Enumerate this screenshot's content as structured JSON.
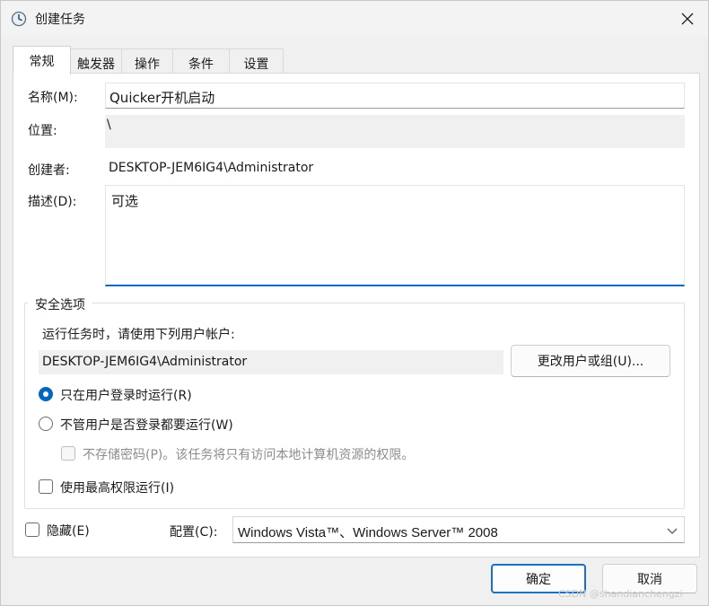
{
  "window": {
    "title": "创建任务"
  },
  "tabs": [
    {
      "label": "常规",
      "active": true
    },
    {
      "label": "触发器",
      "active": false
    },
    {
      "label": "操作",
      "active": false
    },
    {
      "label": "条件",
      "active": false
    },
    {
      "label": "设置",
      "active": false
    }
  ],
  "general": {
    "name_label": "名称(M):",
    "name_value": "Quicker开机启动",
    "location_label": "位置:",
    "location_value": "\\",
    "author_label": "创建者:",
    "author_value": "DESKTOP-JEM6IG4\\Administrator",
    "description_label": "描述(D):",
    "description_value": "可选"
  },
  "security": {
    "group_title": "安全选项",
    "run_as_label": "运行任务时，请使用下列用户帐户:",
    "user_account": "DESKTOP-JEM6IG4\\Administrator",
    "change_user_button": "更改用户或组(U)...",
    "option_logged_on": "只在用户登录时运行(R)",
    "option_logged_on_checked": true,
    "option_whether_logged_on": "不管用户是否登录都要运行(W)",
    "option_whether_logged_on_checked": false,
    "no_store_password": "不存储密码(P)。该任务将只有访问本地计算机资源的权限。",
    "highest_privileges": "使用最高权限运行(I)"
  },
  "footer": {
    "hidden_label": "隐藏(E)",
    "configure_label": "配置(C):",
    "configure_value": "Windows Vista™、Windows Server™ 2008",
    "ok_button": "确定",
    "cancel_button": "取消"
  },
  "watermark": "CSDN @shandianchengzi",
  "colors": {
    "accent": "#0067c0",
    "window_bg": "#f0f0f0",
    "panel_bg": "#ffffff"
  },
  "icons": {
    "title": "clock-icon",
    "close": "close-icon",
    "dropdown": "chevron-down-icon"
  }
}
